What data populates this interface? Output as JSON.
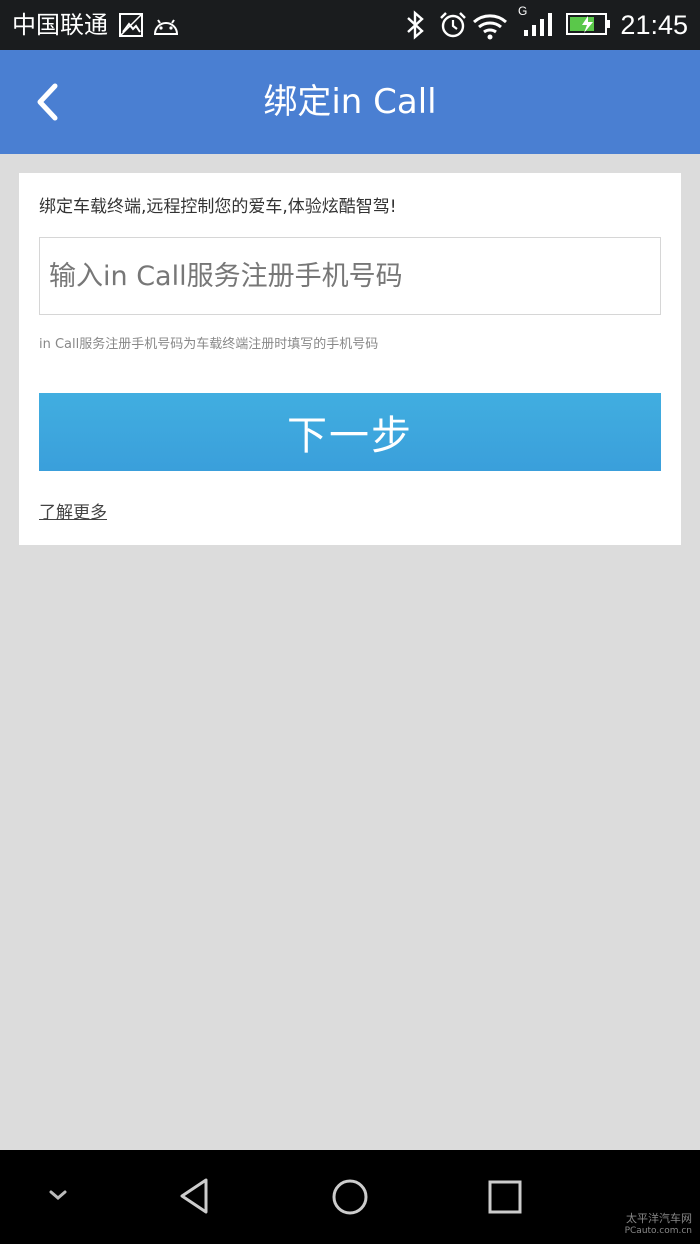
{
  "status_bar": {
    "carrier": "中国联通",
    "network_label": "G",
    "time": "21:45",
    "icons": [
      "gallery-icon",
      "android-icon",
      "bluetooth-icon",
      "alarm-icon",
      "wifi-icon",
      "signal-icon",
      "battery-charging-icon"
    ]
  },
  "app_bar": {
    "title": "绑定in Call",
    "back_icon": "chevron-left-icon",
    "color": "#4a7fd2"
  },
  "form": {
    "intro": "绑定车载终端,远程控制您的爱车,体验炫酷智驾!",
    "phone_placeholder": "输入in Call服务注册手机号码",
    "phone_value": "",
    "hint": "in Call服务注册手机号码为车载终端注册时填写的手机号码",
    "next_label": "下一步",
    "next_color": "#3ea8df",
    "learn_more": "了解更多"
  },
  "nav_bar": {
    "icons": [
      "collapse-icon",
      "back-triangle-icon",
      "home-circle-icon",
      "recents-square-icon"
    ]
  },
  "watermark": {
    "line1": "太平洋汽车网",
    "line2": "PCauto.com.cn"
  }
}
